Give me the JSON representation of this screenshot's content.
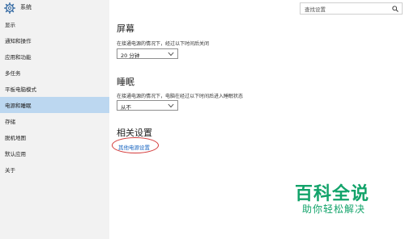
{
  "header": {
    "app_title": "系统",
    "icon": "gear-icon"
  },
  "search": {
    "placeholder": "查找设置",
    "icon": "search-icon"
  },
  "sidebar": {
    "items": [
      {
        "label": "显示",
        "selected": false
      },
      {
        "label": "通知和操作",
        "selected": false
      },
      {
        "label": "应用和功能",
        "selected": false
      },
      {
        "label": "多任务",
        "selected": false
      },
      {
        "label": "平板电脑模式",
        "selected": false
      },
      {
        "label": "电源和睡眠",
        "selected": true
      },
      {
        "label": "存储",
        "selected": false
      },
      {
        "label": "脱机地图",
        "selected": false
      },
      {
        "label": "默认应用",
        "selected": false
      },
      {
        "label": "关于",
        "selected": false
      }
    ]
  },
  "main": {
    "screen": {
      "title": "屏幕",
      "description": "在接通电源的情况下，经过以下时间后关闭",
      "value": "20 分钟"
    },
    "sleep": {
      "title": "睡眠",
      "description": "在接通电源的情况下，电脑在经过以下时间后进入睡眠状态",
      "value": "从不"
    },
    "related": {
      "title": "相关设置",
      "link": "其他电源设置"
    }
  },
  "watermark": {
    "main": "百科全说",
    "sub": "助你轻松解决"
  },
  "colors": {
    "sidebar_bg": "#f2f2f2",
    "selected_bg": "#bcd7f0",
    "link": "#1a66c1",
    "annotation": "#d43a3a",
    "watermark": "#12a36a"
  }
}
